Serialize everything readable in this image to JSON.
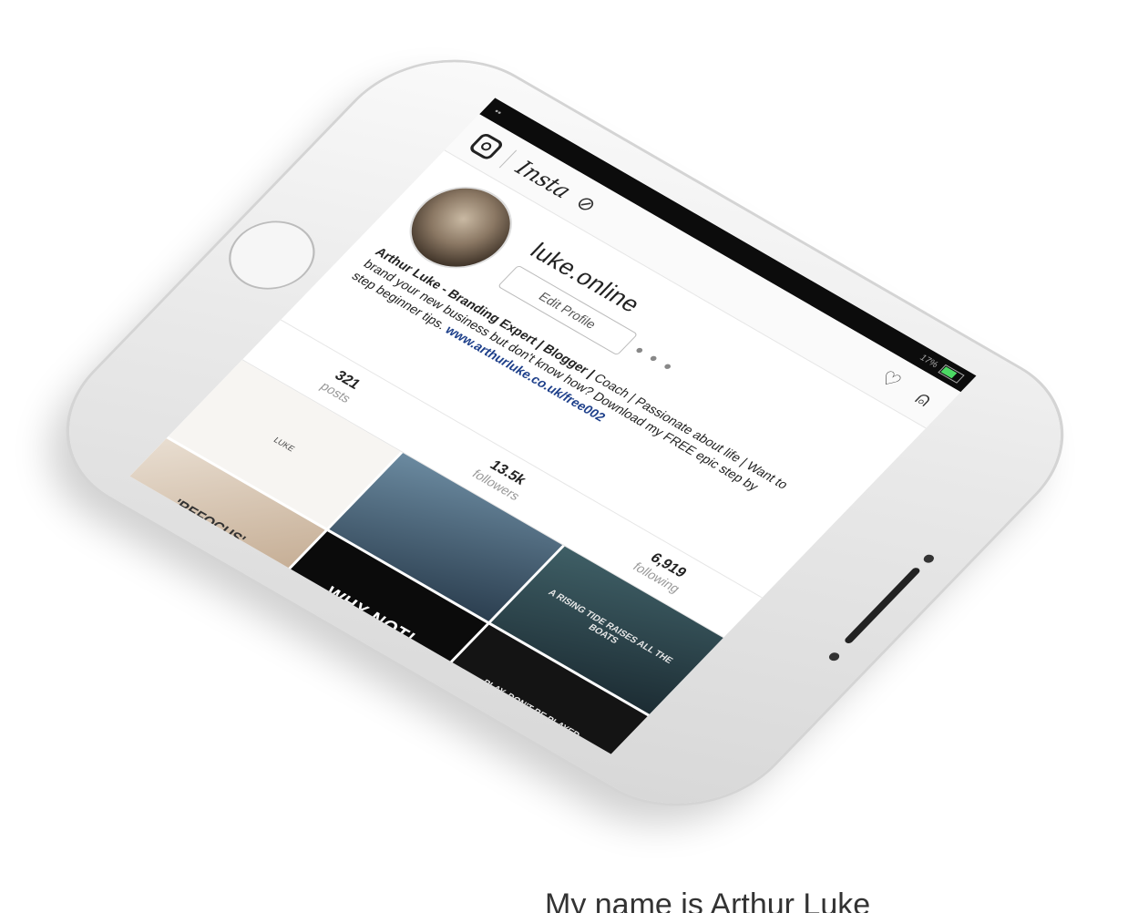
{
  "status_bar": {
    "left": "••",
    "right": "17%"
  },
  "header": {
    "logo": "Insta"
  },
  "profile": {
    "username": "luke.online",
    "edit_button": "Edit Profile",
    "more": "• • •",
    "bio_name": "Arthur Luke - Branding Expert | Blogger |",
    "bio_text": "Coach | Passionate about life | Want to brand your new business but don't know how? Download my FREE epic step by step beginner tips.",
    "bio_link": "www.arthurluke.co.uk/free002"
  },
  "stats": [
    {
      "num": "321",
      "label": "posts"
    },
    {
      "num": "13.5k",
      "label": "followers"
    },
    {
      "num": "6,919",
      "label": "following"
    }
  ],
  "posts": [
    {
      "text": "LUKE",
      "style": "t-white"
    },
    {
      "text": "",
      "style": "t-blue"
    },
    {
      "text": "A RISING TIDE RAISES ALL THE BOATS",
      "style": "t-teal"
    },
    {
      "text": "'REFOCUS'",
      "style": "t-photo1"
    },
    {
      "text": "WHY NOT!",
      "style": "t-black"
    },
    {
      "text": "PLAY, DON'T BE PLAYED",
      "style": "t-dark"
    }
  ],
  "caption": "My name is Arthur Luke"
}
